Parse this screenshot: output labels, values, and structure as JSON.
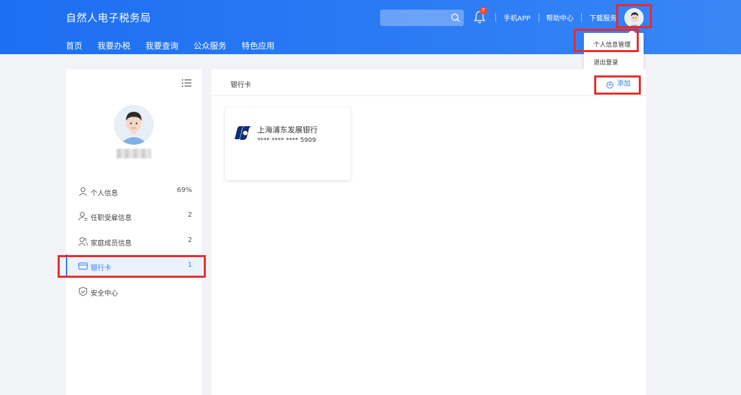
{
  "header": {
    "title": "自然人电子税务局",
    "notification_count": "7",
    "links": [
      "手机APP",
      "帮助中心",
      "下载服务"
    ],
    "nav": [
      "首页",
      "我要办税",
      "我要查询",
      "公众服务",
      "特色应用"
    ]
  },
  "user_menu": {
    "items": [
      "个人信息管理",
      "退出登录"
    ]
  },
  "sidebar": {
    "items": [
      {
        "label": "个人信息",
        "count": "69%",
        "icon": "person-icon"
      },
      {
        "label": "任职受雇信息",
        "count": "2",
        "icon": "employment-icon"
      },
      {
        "label": "家庭成员信息",
        "count": "2",
        "icon": "family-icon"
      },
      {
        "label": "银行卡",
        "count": "1",
        "icon": "card-icon"
      },
      {
        "label": "安全中心",
        "count": "",
        "icon": "shield-icon"
      }
    ]
  },
  "main": {
    "tab": "银行卡",
    "add_label": "添加",
    "cards": [
      {
        "bank": "上海浦东发展银行",
        "number": "**** **** **** 5909"
      }
    ]
  },
  "colors": {
    "header_blue": "#1d6ff2",
    "accent": "#2f7ef5",
    "highlight_red": "#ea2a2a",
    "badge_red": "#ef4b3a"
  }
}
